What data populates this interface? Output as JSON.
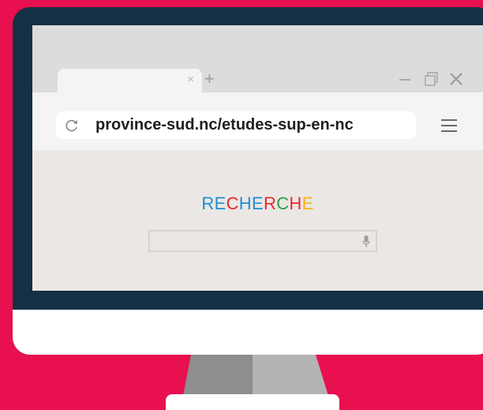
{
  "browser": {
    "tab": {
      "close_glyph": "×"
    },
    "new_tab_glyph": "+",
    "url": "province-sud.nc/etudes-sup-en-nc",
    "window_controls": [
      "minimize-icon",
      "restore-icon",
      "close-icon"
    ],
    "toolbar_icons": [
      "reload-icon",
      "menu-icon"
    ]
  },
  "search": {
    "title_letters": [
      {
        "char": "R",
        "color": "#1e8fd1"
      },
      {
        "char": "E",
        "color": "#1e8fd1"
      },
      {
        "char": "C",
        "color": "#e8262f"
      },
      {
        "char": "H",
        "color": "#1e8fd1"
      },
      {
        "char": "E",
        "color": "#1e8fd1"
      },
      {
        "char": "R",
        "color": "#e8262f"
      },
      {
        "char": "C",
        "color": "#2aa04c"
      },
      {
        "char": "H",
        "color": "#e8262f"
      },
      {
        "char": "E",
        "color": "#f2b51b"
      }
    ],
    "input_value": "",
    "mic_icon": "microphone-icon"
  },
  "colors": {
    "background": "#e8104e",
    "bezel": "#153044",
    "screen": "#ebe7e4"
  }
}
